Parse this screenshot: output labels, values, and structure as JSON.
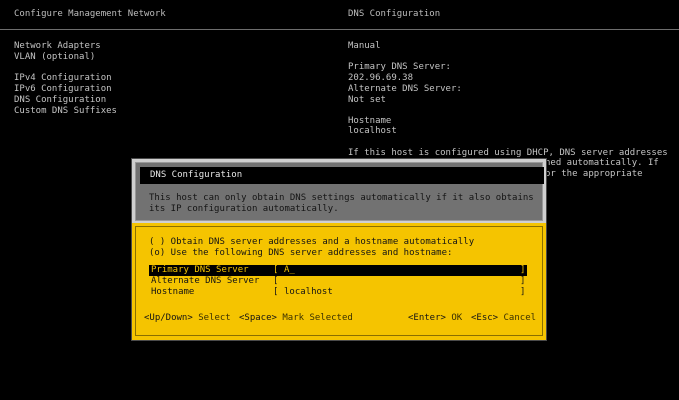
{
  "header": {
    "left_title": "Configure Management Network",
    "right_title": "DNS Configuration"
  },
  "menu": {
    "items": [
      {
        "label": "Network Adapters"
      },
      {
        "label": "VLAN (optional)"
      },
      {
        "label": "IPv4 Configuration"
      },
      {
        "label": "IPv6 Configuration"
      },
      {
        "label": "DNS Configuration"
      },
      {
        "label": "Custom DNS Suffixes"
      }
    ]
  },
  "info": {
    "mode": "Manual",
    "primary_label": "Primary DNS Server:",
    "primary_value": "202.96.69.38",
    "alternate_label": "Alternate DNS Server:",
    "alternate_value": "Not set",
    "hostname_label": "Hostname",
    "hostname_value": "localhost",
    "note_line1": "If this host is configured using DHCP, DNS server addresses",
    "note_line2": "ned automatically. If",
    "note_line3": "or the appropriate"
  },
  "dialog": {
    "title": "DNS Configuration",
    "message_line1": "This host can only obtain DNS settings automatically if it also obtains",
    "message_line2": "its IP configuration automatically.",
    "option_auto": "( ) Obtain DNS server addresses and a hostname automatically",
    "option_manual": "(o) Use the following DNS server addresses and hostname:",
    "fields": [
      {
        "label": "Primary DNS Server",
        "value": "A_"
      },
      {
        "label": "Alternate DNS Server",
        "value": ""
      },
      {
        "label": "Hostname",
        "value": "localhost"
      }
    ],
    "bracket_open": "[",
    "bracket_close": "]",
    "keys": {
      "updown_key": "<Up/Down>",
      "updown_text": "Select",
      "space_key": "<Space>",
      "space_text": "Mark Selected",
      "enter_key": "<Enter>",
      "enter_text": "OK",
      "esc_key": "<Esc>",
      "esc_text": "Cancel"
    }
  },
  "colors": {
    "background": "#000000",
    "dialog_body": "#f5c400",
    "dialog_header": "#727272"
  }
}
